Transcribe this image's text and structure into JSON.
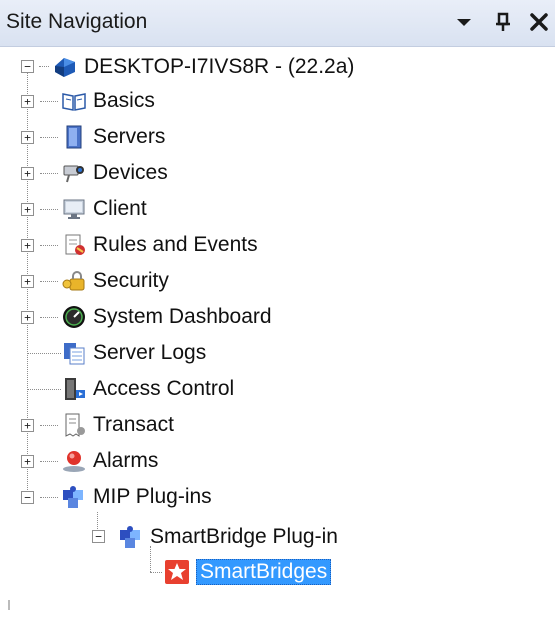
{
  "panel": {
    "title": "Site Navigation",
    "buttons": {
      "dropdown_icon": "chevron-down-icon",
      "pin_icon": "pin-icon",
      "close_icon": "close-icon"
    }
  },
  "tree": {
    "root": {
      "label": "DESKTOP-I7IVS8R - (22.2a)",
      "icon": "server-logo-icon",
      "expanded": true
    },
    "items": [
      {
        "label": "Basics",
        "icon": "book-icon",
        "expander": "+"
      },
      {
        "label": "Servers",
        "icon": "server-icon",
        "expander": "+"
      },
      {
        "label": "Devices",
        "icon": "camera-icon",
        "expander": "+"
      },
      {
        "label": "Client",
        "icon": "monitor-icon",
        "expander": "+"
      },
      {
        "label": "Rules and Events",
        "icon": "rules-icon",
        "expander": "+"
      },
      {
        "label": "Security",
        "icon": "keys-icon",
        "expander": "+"
      },
      {
        "label": "System Dashboard",
        "icon": "gauge-icon",
        "expander": "+"
      },
      {
        "label": "Server Logs",
        "icon": "logs-icon",
        "expander": ""
      },
      {
        "label": "Access Control",
        "icon": "door-icon",
        "expander": ""
      },
      {
        "label": "Transact",
        "icon": "receipt-icon",
        "expander": "+"
      },
      {
        "label": "Alarms",
        "icon": "alarm-icon",
        "expander": "+"
      },
      {
        "label": "MIP Plug-ins",
        "icon": "puzzle-icon",
        "expander": "−"
      }
    ],
    "plugin": {
      "label": "SmartBridge Plug-in",
      "icon": "puzzle-icon",
      "expander": "−"
    },
    "leaf": {
      "label": "SmartBridges",
      "icon": "smartbridge-icon",
      "selected": true
    }
  },
  "colors": {
    "selection": "#3399ff",
    "titlebar": "#dde5f3"
  }
}
